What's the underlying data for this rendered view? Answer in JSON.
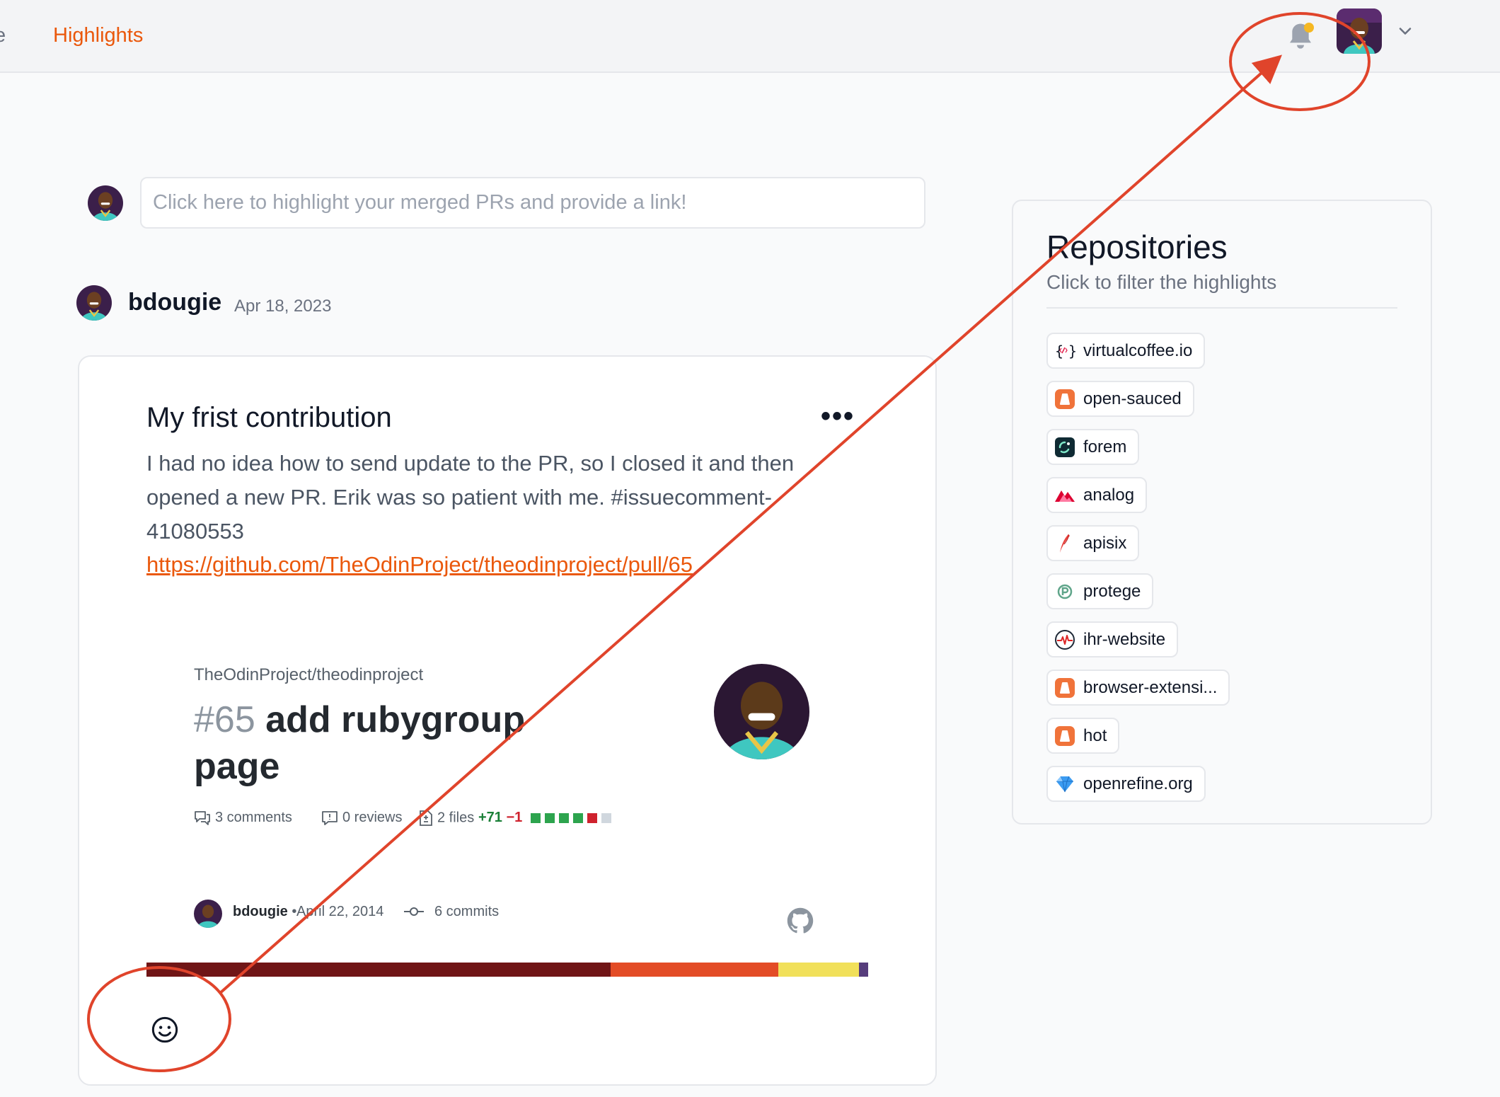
{
  "nav": {
    "partial_item": "e",
    "highlights": "Highlights"
  },
  "composer": {
    "placeholder": "Click here to highlight your merged PRs and provide a link!"
  },
  "post": {
    "author": "bdougie",
    "date": "Apr 18, 2023",
    "title": "My frist contribution",
    "menu": "•••",
    "body": "I had no idea how to send update to the PR, so I closed it and then opened a new PR. Erik was so patient with me. #issuecomment-41080553",
    "link": "https://github.com/TheOdinProject/theodinproject/pull/65"
  },
  "preview": {
    "repo": "TheOdinProject/theodinproject",
    "number": "#65",
    "title": "add rubygroup page",
    "comments": "3 comments",
    "reviews": "0 reviews",
    "files": "2 files",
    "additions": "+71",
    "deletions": "−1",
    "author": "bdougie",
    "separator": "•",
    "date": "April 22, 2014",
    "commits": "6 commits",
    "diff_squares": [
      "#2da44e",
      "#2da44e",
      "#2da44e",
      "#2da44e",
      "#cf222e",
      "#d0d7de"
    ],
    "language_bar": [
      {
        "color": "#701516",
        "fraction": 0.643
      },
      {
        "color": "#e34c26",
        "fraction": 0.232
      },
      {
        "color": "#f1e05a",
        "fraction": 0.112
      },
      {
        "color": "#563d7c",
        "fraction": 0.013
      }
    ]
  },
  "repositories": {
    "title": "Repositories",
    "subtitle": "Click to filter the highlights",
    "items": [
      {
        "name": "virtualcoffee.io",
        "icon": "virtualcoffee-icon"
      },
      {
        "name": "open-sauced",
        "icon": "open-sauced-icon"
      },
      {
        "name": "forem",
        "icon": "forem-icon"
      },
      {
        "name": "analog",
        "icon": "analog-icon"
      },
      {
        "name": "apisix",
        "icon": "apisix-icon"
      },
      {
        "name": "protege",
        "icon": "protege-icon"
      },
      {
        "name": "ihr-website",
        "icon": "ihr-icon"
      },
      {
        "name": "browser-extensi...",
        "icon": "open-sauced-icon"
      },
      {
        "name": "hot",
        "icon": "open-sauced-icon"
      },
      {
        "name": "openrefine.org",
        "icon": "diamond-icon"
      }
    ]
  },
  "colors": {
    "accent": "#ea580c",
    "annotation": "#e0442b",
    "notification_dot": "#f5b823"
  }
}
